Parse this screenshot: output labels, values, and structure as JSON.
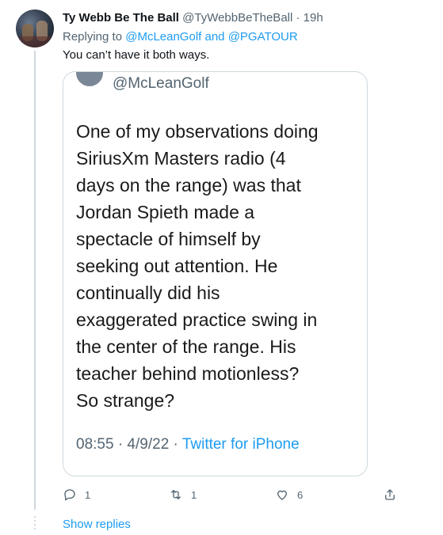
{
  "tweet": {
    "author_name": "Ty Webb Be The Ball",
    "author_handle": "@TyWebbBeTheBall",
    "separator": "·",
    "time": "19h",
    "replying_prefix": "Replying to",
    "replying_to_1": "@McLeanGolf",
    "replying_and": "and",
    "replying_to_2": "@PGATOUR",
    "text": "You can’t have it both ways."
  },
  "quoted_image": {
    "handle": "@McLeanGolf",
    "lines": [
      "One of my observations doing",
      "SiriusXm Masters radio (4",
      "days on the range) was that",
      "Jordan Spieth made a",
      "spectacle of himself by",
      "seeking out attention. He",
      "continually did his",
      "exaggerated practice swing in",
      "the center of the range. His",
      "teacher behind motionless?",
      "So strange?"
    ],
    "meta_time": "08:55 · 4/9/22 ·",
    "meta_source": "Twitter for iPhone"
  },
  "actions": {
    "reply_count": "1",
    "retweet_count": "1",
    "like_count": "6"
  },
  "show_replies": "Show replies",
  "colors": {
    "accent": "#1d9bf0",
    "muted": "#536471",
    "text": "#0f1419",
    "border": "#cfd9de"
  },
  "icons": [
    "reply-icon",
    "retweet-icon",
    "like-icon",
    "share-icon"
  ]
}
